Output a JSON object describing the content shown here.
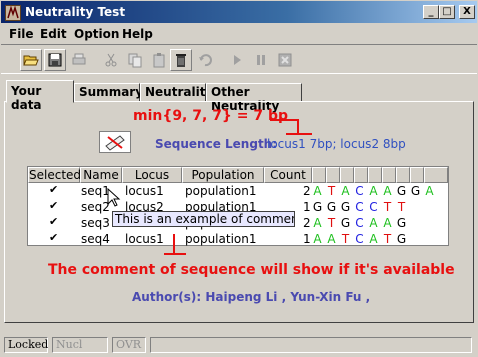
{
  "window": {
    "title": "Neutrality Test",
    "minimize": "_",
    "maximize": "□",
    "close": "X"
  },
  "menu": [
    "File",
    "Edit",
    "Option",
    "Help"
  ],
  "tabs": [
    "Your data",
    "Summary",
    "Neutrality",
    "Other Neutrality"
  ],
  "annotation_min": "min{9, 7, 7} = 7 bp",
  "sequence_length_label": "Sequence Length:",
  "sequence_length_value": "locus1 7bp; locus2 8bp",
  "table": {
    "headers": [
      "Selected",
      "Name",
      "Locus",
      "Population",
      "Count"
    ],
    "rows": [
      {
        "selected": "✔",
        "name": "seq1",
        "locus": "locus1",
        "population": "population1",
        "count": "2",
        "bases": [
          "A",
          "T",
          "A",
          "C",
          "A",
          "A",
          "G",
          "G",
          "A"
        ]
      },
      {
        "selected": "✔",
        "name": "seq2",
        "locus": "locus2",
        "population": "population1",
        "count": "1",
        "bases": [
          "G",
          "G",
          "G",
          "C",
          "C",
          "T",
          "T",
          ""
        ]
      },
      {
        "selected": "✔",
        "name": "seq3",
        "locus": "",
        "population": "population1",
        "count": "2",
        "bases": [
          "A",
          "T",
          "G",
          "C",
          "A",
          "A",
          "G"
        ]
      },
      {
        "selected": "✔",
        "name": "seq4",
        "locus": "locus1",
        "population": "population1",
        "count": "1",
        "bases": [
          "A",
          "A",
          "T",
          "C",
          "A",
          "T",
          "G"
        ]
      }
    ]
  },
  "tooltip": "This is an example of comment",
  "annotation_comment": "The comment of sequence will show if it's available",
  "authors": "Author(s): Haipeng Li , Yun-Xin Fu ,",
  "status": [
    "Locked",
    "Nucl",
    "OVR",
    ""
  ],
  "colors": {
    "A": "#20c020",
    "T": "#e01010",
    "G": "#000000",
    "C": "#2020e0",
    "annotation": "#e81010",
    "info": "#4a4ab0"
  }
}
